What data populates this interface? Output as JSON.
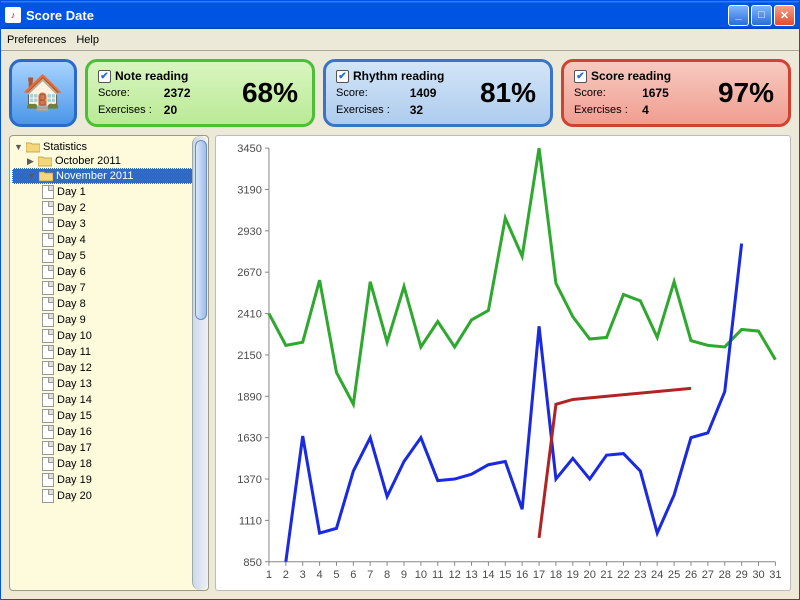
{
  "window": {
    "title": "Score Date"
  },
  "menu": {
    "preferences": "Preferences",
    "help": "Help"
  },
  "cards": {
    "note": {
      "title": "Note reading",
      "score_label": "Score:",
      "score": "2372",
      "ex_label": "Exercises :",
      "ex": "20",
      "pct": "68%"
    },
    "rhythm": {
      "title": "Rhythm reading",
      "score_label": "Score:",
      "score": "1409",
      "ex_label": "Exercises :",
      "ex": "32",
      "pct": "81%"
    },
    "scorer": {
      "title": "Score reading",
      "score_label": "Score:",
      "score": "1675",
      "ex_label": "Exercises :",
      "ex": "4",
      "pct": "97%"
    }
  },
  "tree": {
    "root": "Statistics",
    "months": [
      "October 2011",
      "November 2011"
    ],
    "selected": "November 2011",
    "days": [
      "Day 1",
      "Day 2",
      "Day 3",
      "Day 4",
      "Day 5",
      "Day 6",
      "Day 7",
      "Day 8",
      "Day 9",
      "Day 10",
      "Day 11",
      "Day 12",
      "Day 13",
      "Day 14",
      "Day 15",
      "Day 16",
      "Day 17",
      "Day 18",
      "Day 19",
      "Day 20"
    ]
  },
  "chart_data": {
    "type": "line",
    "x": [
      1,
      2,
      3,
      4,
      5,
      6,
      7,
      8,
      9,
      10,
      11,
      12,
      13,
      14,
      15,
      16,
      17,
      18,
      19,
      20,
      21,
      22,
      23,
      24,
      25,
      26,
      27,
      28,
      29,
      30,
      31
    ],
    "ylim": [
      850,
      3450
    ],
    "yticks": [
      850,
      1110,
      1370,
      1630,
      1890,
      2150,
      2410,
      2670,
      2930,
      3190,
      3450
    ],
    "series": [
      {
        "name": "Note reading",
        "color": "#2fa82f",
        "values": [
          2410,
          2210,
          2230,
          2620,
          2040,
          1840,
          2610,
          2230,
          2580,
          2200,
          2360,
          2200,
          2370,
          2430,
          3010,
          2770,
          3450,
          2600,
          2390,
          2250,
          2260,
          2530,
          2490,
          2260,
          2610,
          2240,
          2210,
          2200,
          2310,
          2300,
          2120
        ]
      },
      {
        "name": "Rhythm reading",
        "color": "#1a2ae0",
        "x": [
          2,
          3,
          4,
          5,
          6,
          7,
          8,
          9,
          10,
          11,
          12,
          13,
          14,
          15,
          16,
          17,
          18,
          19,
          20,
          21,
          22,
          23,
          24,
          25,
          26,
          27,
          28,
          29
        ],
        "values": [
          850,
          1640,
          1030,
          1060,
          1420,
          1630,
          1260,
          1480,
          1630,
          1360,
          1370,
          1400,
          1460,
          1480,
          1180,
          2330,
          1370,
          1500,
          1370,
          1520,
          1530,
          1420,
          1030,
          1270,
          1630,
          1660,
          1920,
          2850
        ]
      },
      {
        "name": "Score reading",
        "color": "#b02424",
        "x": [
          17,
          18,
          19,
          26
        ],
        "values": [
          1000,
          1840,
          1870,
          1940
        ]
      }
    ]
  }
}
